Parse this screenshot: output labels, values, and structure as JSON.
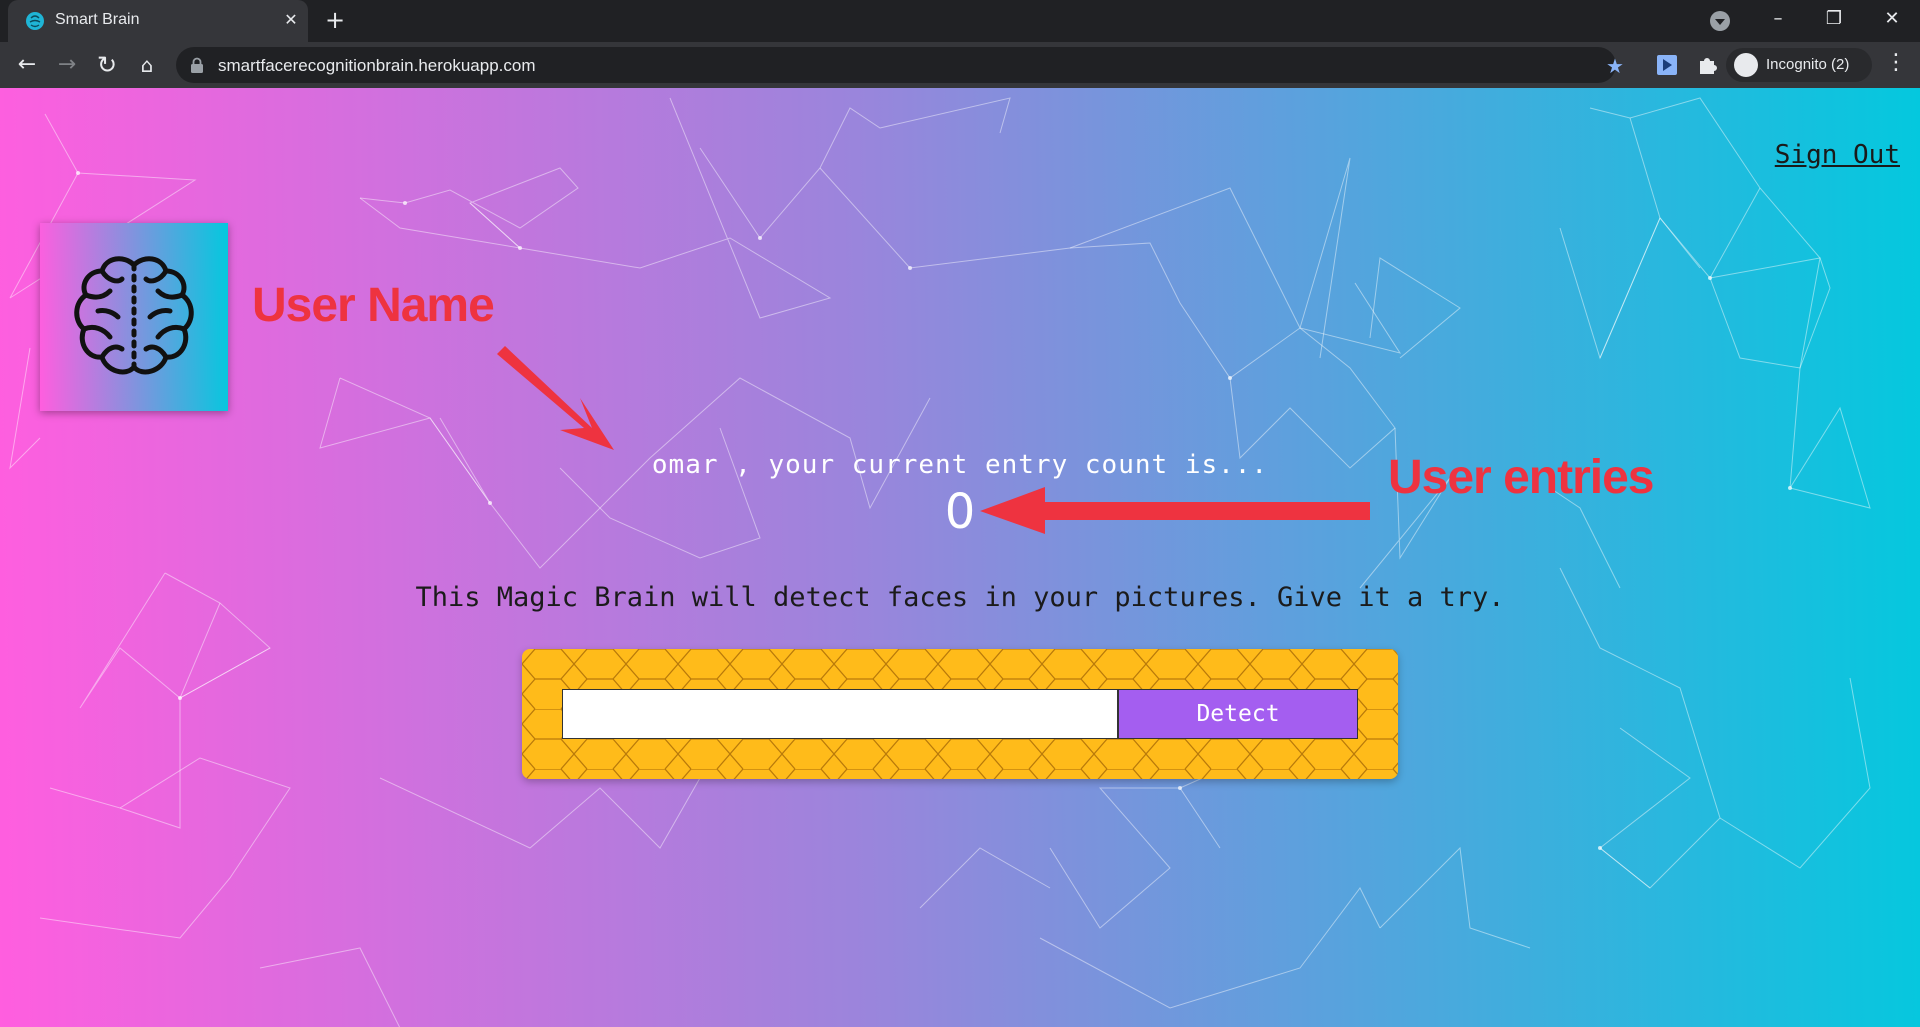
{
  "browser": {
    "tab_title": "Smart Brain",
    "url": "smartfacerecognitionbrain.herokuapp.com",
    "profile_label": "Incognito (2)"
  },
  "page": {
    "sign_out_label": "Sign Out",
    "greeting": "omar , your current entry count is...",
    "entry_count": "0",
    "intro_text": "This Magic Brain will detect faces in your pictures. Give it a try.",
    "image_url_value": "",
    "detect_label": "Detect"
  },
  "annotations": {
    "user_name_label": "User Name",
    "user_entries_label": "User entries"
  },
  "colors": {
    "annotation": "#ee3340",
    "detect_button": "#a45ef0",
    "form_panel": "#ffbb1a"
  },
  "icons": [
    "brain-icon",
    "lock-icon",
    "star-icon",
    "extensions-icon",
    "incognito-icon"
  ]
}
